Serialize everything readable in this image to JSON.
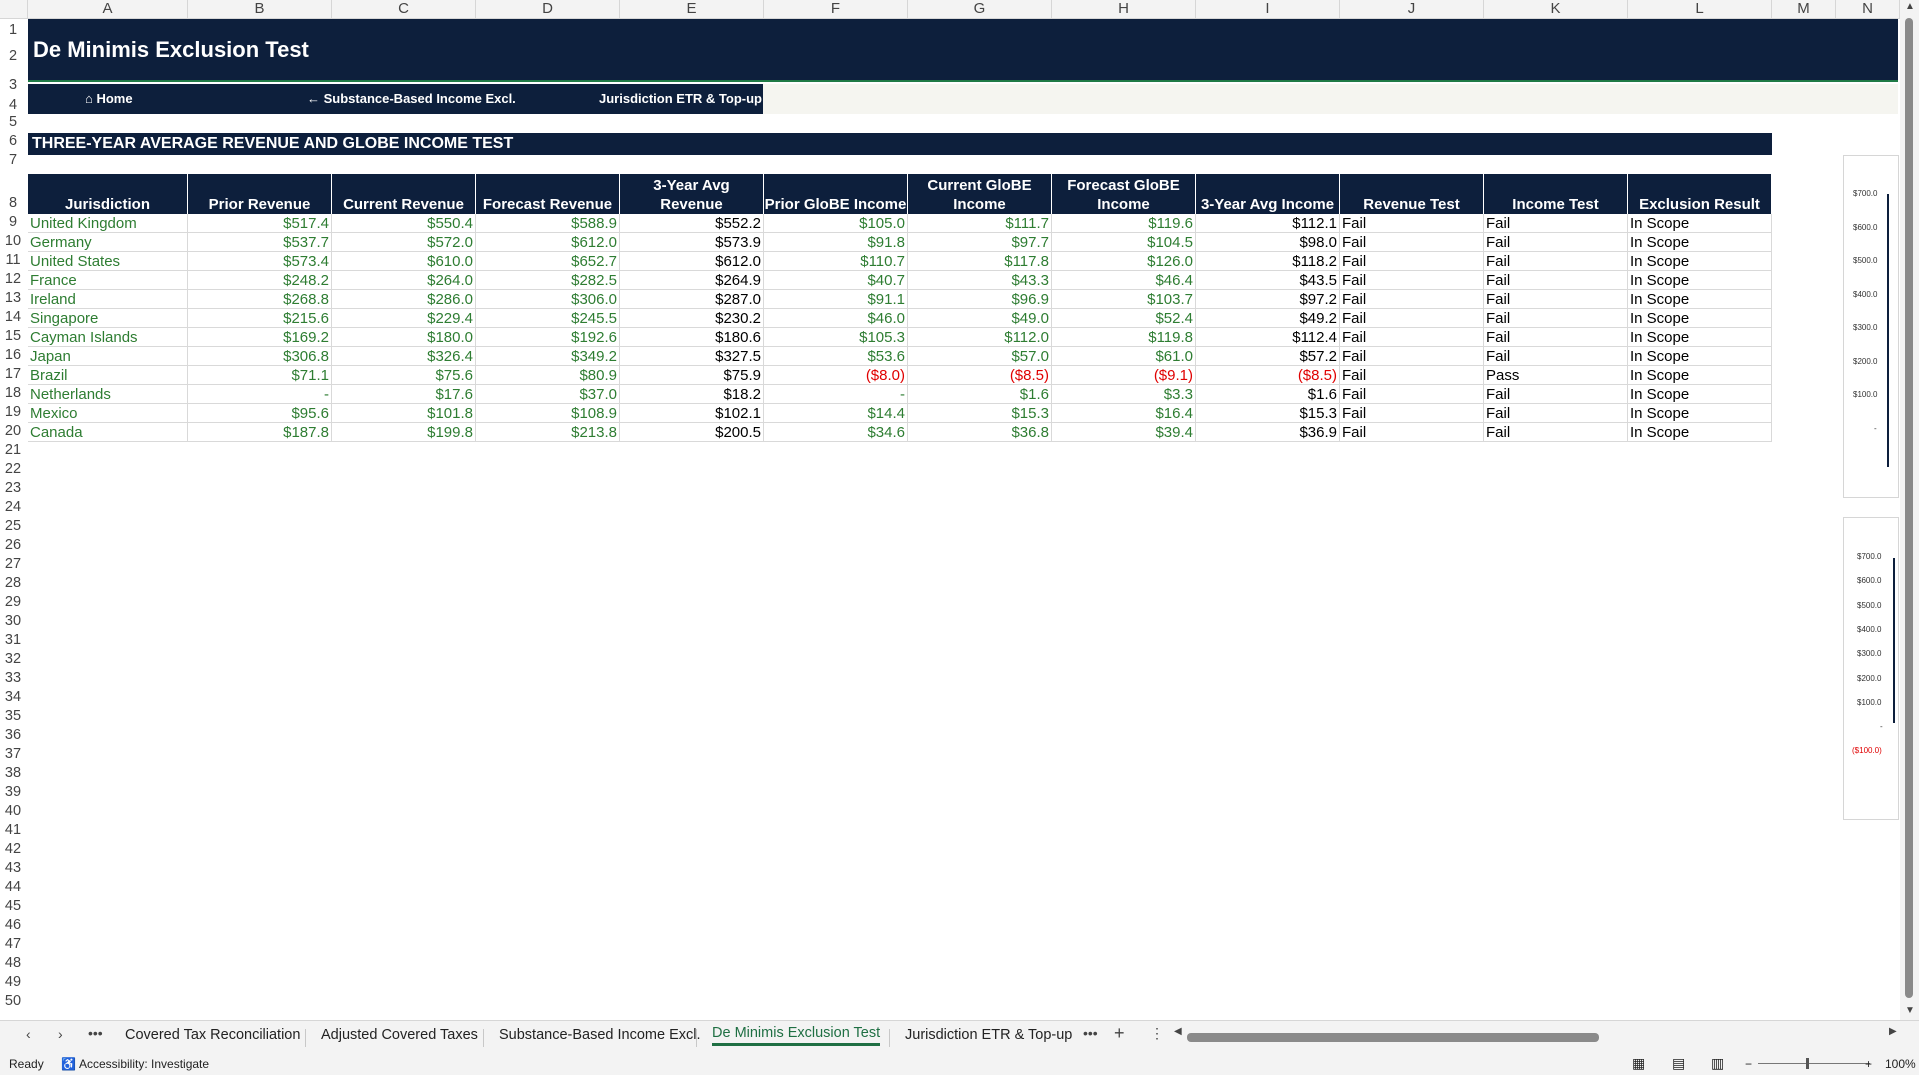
{
  "columns": [
    "A",
    "B",
    "C",
    "D",
    "E",
    "F",
    "G",
    "H",
    "I",
    "J",
    "K",
    "L",
    "M",
    "N"
  ],
  "rows": [
    "1",
    "2",
    "3",
    "4",
    "5",
    "6",
    "7",
    "8",
    "9",
    "10",
    "11",
    "12",
    "13",
    "14",
    "15",
    "16",
    "17",
    "18",
    "19",
    "20",
    "21",
    "22",
    "23",
    "24",
    "25",
    "26",
    "27",
    "28",
    "29",
    "30",
    "31",
    "32",
    "33",
    "34",
    "35",
    "36",
    "37",
    "38",
    "39",
    "40",
    "41",
    "42",
    "43",
    "44",
    "45",
    "46",
    "47",
    "48",
    "49",
    "50"
  ],
  "title": "De Minimis Exclusion Test",
  "nav": {
    "home": "⌂ Home",
    "prev": "← Substance-Based Income Excl.",
    "next": "Jurisdiction ETR & Top-up Ta"
  },
  "section_title": "THREE-YEAR AVERAGE REVENUE AND GLOBE INCOME TEST",
  "table": {
    "headers": [
      "Jurisdiction",
      "Prior Revenue",
      "Current Revenue",
      "Forecast Revenue",
      "3-Year Avg Revenue",
      "Prior GloBE Income",
      "Current GloBE Income",
      "Forecast GloBE Income",
      "3-Year Avg Income",
      "Revenue Test",
      "Income Test",
      "Exclusion Result"
    ],
    "rows": [
      [
        "United Kingdom",
        "$517.4",
        "$550.4",
        "$588.9",
        "$552.2",
        "$105.0",
        "$111.7",
        "$119.6",
        "$112.1",
        "Fail",
        "Fail",
        "In Scope"
      ],
      [
        "Germany",
        "$537.7",
        "$572.0",
        "$612.0",
        "$573.9",
        "$91.8",
        "$97.7",
        "$104.5",
        "$98.0",
        "Fail",
        "Fail",
        "In Scope"
      ],
      [
        "United States",
        "$573.4",
        "$610.0",
        "$652.7",
        "$612.0",
        "$110.7",
        "$117.8",
        "$126.0",
        "$118.2",
        "Fail",
        "Fail",
        "In Scope"
      ],
      [
        "France",
        "$248.2",
        "$264.0",
        "$282.5",
        "$264.9",
        "$40.7",
        "$43.3",
        "$46.4",
        "$43.5",
        "Fail",
        "Fail",
        "In Scope"
      ],
      [
        "Ireland",
        "$268.8",
        "$286.0",
        "$306.0",
        "$287.0",
        "$91.1",
        "$96.9",
        "$103.7",
        "$97.2",
        "Fail",
        "Fail",
        "In Scope"
      ],
      [
        "Singapore",
        "$215.6",
        "$229.4",
        "$245.5",
        "$230.2",
        "$46.0",
        "$49.0",
        "$52.4",
        "$49.2",
        "Fail",
        "Fail",
        "In Scope"
      ],
      [
        "Cayman Islands",
        "$169.2",
        "$180.0",
        "$192.6",
        "$180.6",
        "$105.3",
        "$112.0",
        "$119.8",
        "$112.4",
        "Fail",
        "Fail",
        "In Scope"
      ],
      [
        "Japan",
        "$306.8",
        "$326.4",
        "$349.2",
        "$327.5",
        "$53.6",
        "$57.0",
        "$61.0",
        "$57.2",
        "Fail",
        "Fail",
        "In Scope"
      ],
      [
        "Brazil",
        "$71.1",
        "$75.6",
        "$80.9",
        "$75.9",
        "($8.0)",
        "($8.5)",
        "($9.1)",
        "($8.5)",
        "Fail",
        "Pass",
        "In Scope"
      ],
      [
        "Netherlands",
        "-",
        "$17.6",
        "$37.0",
        "$18.2",
        "-",
        "$1.6",
        "$3.3",
        "$1.6",
        "Fail",
        "Fail",
        "In Scope"
      ],
      [
        "Mexico",
        "$95.6",
        "$101.8",
        "$108.9",
        "$102.1",
        "$14.4",
        "$15.3",
        "$16.4",
        "$15.3",
        "Fail",
        "Fail",
        "In Scope"
      ],
      [
        "Canada",
        "$187.8",
        "$199.8",
        "$213.8",
        "$200.5",
        "$34.6",
        "$36.8",
        "$39.4",
        "$36.9",
        "Fail",
        "Fail",
        "In Scope"
      ]
    ]
  },
  "chart1_ticks": [
    "$700.0",
    "$600.0",
    "$500.0",
    "$400.0",
    "$300.0",
    "$200.0",
    "$100.0",
    "-"
  ],
  "chart2_ticks": [
    "$700.0",
    "$600.0",
    "$500.0",
    "$400.0",
    "$300.0",
    "$200.0",
    "$100.0",
    "-",
    "($100.0)"
  ],
  "sheet_tabs": [
    "Covered Tax Reconciliation",
    "Adjusted Covered Taxes",
    "Substance-Based Income Excl.",
    "De Minimis Exclusion Test",
    "Jurisdiction ETR & Top-up T"
  ],
  "active_tab": 3,
  "status": {
    "ready": "Ready",
    "accessibility": "Accessibility: Investigate",
    "zoom": "100%"
  }
}
